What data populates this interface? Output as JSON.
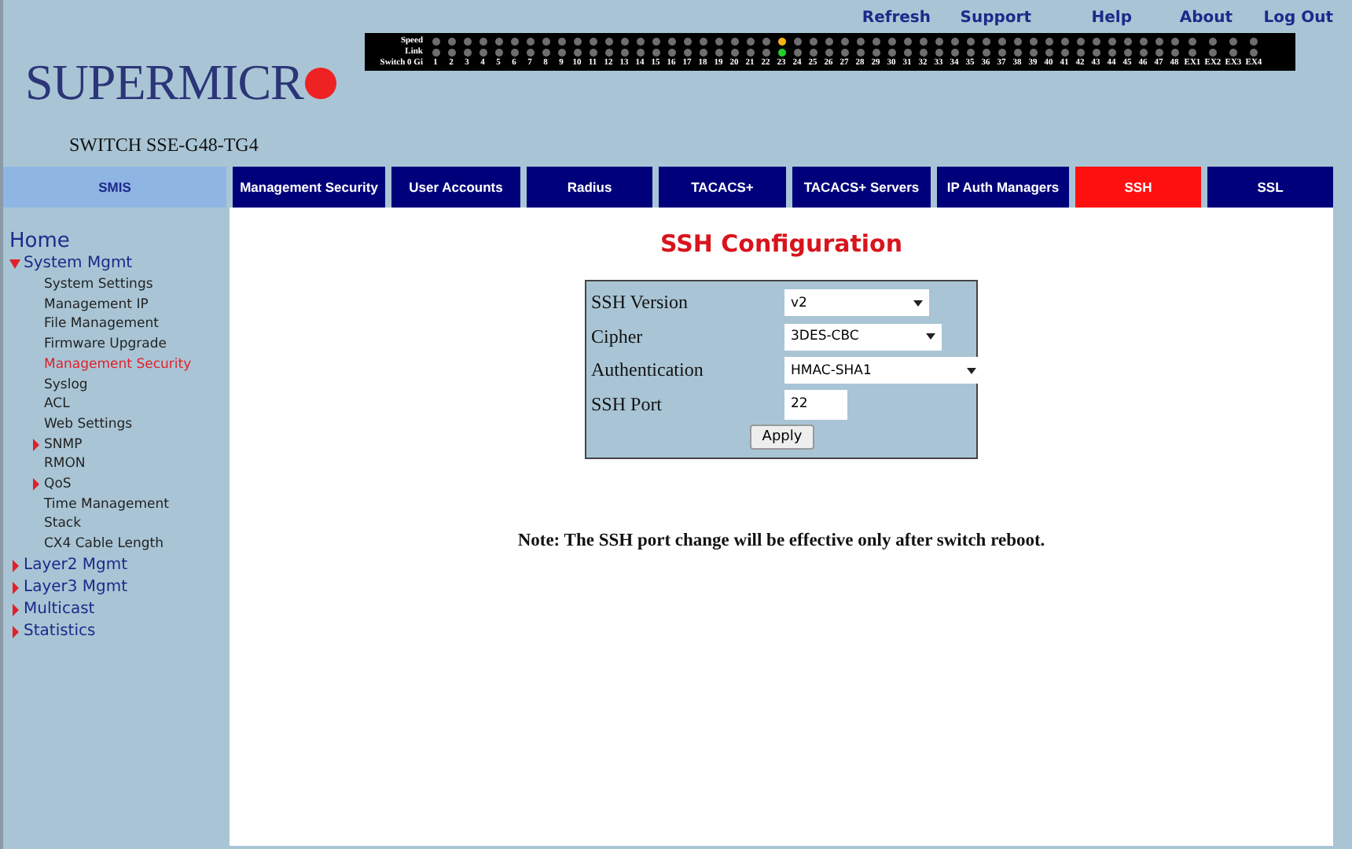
{
  "logo": {
    "text": "SUPERMICR",
    "model": "SWITCH SSE-G48-TG4"
  },
  "top_links": [
    "Refresh",
    "Support",
    "Help",
    "About",
    "Log Out"
  ],
  "port_panel": {
    "row_labels": [
      "Speed",
      "Link",
      "Switch 0 Gi"
    ],
    "ports": [
      {
        "label": "1",
        "speed": {
          "color": "#6e6e6e"
        },
        "link": {
          "color": "#6e6e6e"
        }
      },
      {
        "label": "2",
        "speed": {
          "color": "#6e6e6e"
        },
        "link": {
          "color": "#6e6e6e"
        }
      },
      {
        "label": "3",
        "speed": {
          "color": "#6e6e6e"
        },
        "link": {
          "color": "#6e6e6e"
        }
      },
      {
        "label": "4",
        "speed": {
          "color": "#6e6e6e"
        },
        "link": {
          "color": "#6e6e6e"
        }
      },
      {
        "label": "5",
        "speed": {
          "color": "#6e6e6e"
        },
        "link": {
          "color": "#6e6e6e"
        }
      },
      {
        "label": "6",
        "speed": {
          "color": "#6e6e6e"
        },
        "link": {
          "color": "#6e6e6e"
        }
      },
      {
        "label": "7",
        "speed": {
          "color": "#6e6e6e"
        },
        "link": {
          "color": "#6e6e6e"
        }
      },
      {
        "label": "8",
        "speed": {
          "color": "#6e6e6e"
        },
        "link": {
          "color": "#6e6e6e"
        }
      },
      {
        "label": "9",
        "speed": {
          "color": "#6e6e6e"
        },
        "link": {
          "color": "#6e6e6e"
        }
      },
      {
        "label": "10",
        "speed": {
          "color": "#6e6e6e"
        },
        "link": {
          "color": "#6e6e6e"
        }
      },
      {
        "label": "11",
        "speed": {
          "color": "#6e6e6e"
        },
        "link": {
          "color": "#6e6e6e"
        }
      },
      {
        "label": "12",
        "speed": {
          "color": "#6e6e6e"
        },
        "link": {
          "color": "#6e6e6e"
        }
      },
      {
        "label": "13",
        "speed": {
          "color": "#6e6e6e"
        },
        "link": {
          "color": "#6e6e6e"
        }
      },
      {
        "label": "14",
        "speed": {
          "color": "#6e6e6e"
        },
        "link": {
          "color": "#6e6e6e"
        }
      },
      {
        "label": "15",
        "speed": {
          "color": "#6e6e6e"
        },
        "link": {
          "color": "#6e6e6e"
        }
      },
      {
        "label": "16",
        "speed": {
          "color": "#6e6e6e"
        },
        "link": {
          "color": "#6e6e6e"
        }
      },
      {
        "label": "17",
        "speed": {
          "color": "#6e6e6e"
        },
        "link": {
          "color": "#6e6e6e"
        }
      },
      {
        "label": "18",
        "speed": {
          "color": "#6e6e6e"
        },
        "link": {
          "color": "#6e6e6e"
        }
      },
      {
        "label": "19",
        "speed": {
          "color": "#6e6e6e"
        },
        "link": {
          "color": "#6e6e6e"
        }
      },
      {
        "label": "20",
        "speed": {
          "color": "#6e6e6e"
        },
        "link": {
          "color": "#6e6e6e"
        }
      },
      {
        "label": "21",
        "speed": {
          "color": "#6e6e6e"
        },
        "link": {
          "color": "#6e6e6e"
        }
      },
      {
        "label": "22",
        "speed": {
          "color": "#6e6e6e"
        },
        "link": {
          "color": "#6e6e6e"
        }
      },
      {
        "label": "23",
        "speed": {
          "color": "#f5b21a"
        },
        "link": {
          "color": "#22d02a"
        }
      },
      {
        "label": "24",
        "speed": {
          "color": "#6e6e6e"
        },
        "link": {
          "color": "#6e6e6e"
        }
      },
      {
        "label": "25",
        "speed": {
          "color": "#6e6e6e"
        },
        "link": {
          "color": "#6e6e6e"
        }
      },
      {
        "label": "26",
        "speed": {
          "color": "#6e6e6e"
        },
        "link": {
          "color": "#6e6e6e"
        }
      },
      {
        "label": "27",
        "speed": {
          "color": "#6e6e6e"
        },
        "link": {
          "color": "#6e6e6e"
        }
      },
      {
        "label": "28",
        "speed": {
          "color": "#6e6e6e"
        },
        "link": {
          "color": "#6e6e6e"
        }
      },
      {
        "label": "29",
        "speed": {
          "color": "#6e6e6e"
        },
        "link": {
          "color": "#6e6e6e"
        }
      },
      {
        "label": "30",
        "speed": {
          "color": "#6e6e6e"
        },
        "link": {
          "color": "#6e6e6e"
        }
      },
      {
        "label": "31",
        "speed": {
          "color": "#6e6e6e"
        },
        "link": {
          "color": "#6e6e6e"
        }
      },
      {
        "label": "32",
        "speed": {
          "color": "#6e6e6e"
        },
        "link": {
          "color": "#6e6e6e"
        }
      },
      {
        "label": "33",
        "speed": {
          "color": "#6e6e6e"
        },
        "link": {
          "color": "#6e6e6e"
        }
      },
      {
        "label": "34",
        "speed": {
          "color": "#6e6e6e"
        },
        "link": {
          "color": "#6e6e6e"
        }
      },
      {
        "label": "35",
        "speed": {
          "color": "#6e6e6e"
        },
        "link": {
          "color": "#6e6e6e"
        }
      },
      {
        "label": "36",
        "speed": {
          "color": "#6e6e6e"
        },
        "link": {
          "color": "#6e6e6e"
        }
      },
      {
        "label": "37",
        "speed": {
          "color": "#6e6e6e"
        },
        "link": {
          "color": "#6e6e6e"
        }
      },
      {
        "label": "38",
        "speed": {
          "color": "#6e6e6e"
        },
        "link": {
          "color": "#6e6e6e"
        }
      },
      {
        "label": "39",
        "speed": {
          "color": "#6e6e6e"
        },
        "link": {
          "color": "#6e6e6e"
        }
      },
      {
        "label": "40",
        "speed": {
          "color": "#6e6e6e"
        },
        "link": {
          "color": "#6e6e6e"
        }
      },
      {
        "label": "41",
        "speed": {
          "color": "#6e6e6e"
        },
        "link": {
          "color": "#6e6e6e"
        }
      },
      {
        "label": "42",
        "speed": {
          "color": "#6e6e6e"
        },
        "link": {
          "color": "#6e6e6e"
        }
      },
      {
        "label": "43",
        "speed": {
          "color": "#6e6e6e"
        },
        "link": {
          "color": "#6e6e6e"
        }
      },
      {
        "label": "44",
        "speed": {
          "color": "#6e6e6e"
        },
        "link": {
          "color": "#6e6e6e"
        }
      },
      {
        "label": "45",
        "speed": {
          "color": "#6e6e6e"
        },
        "link": {
          "color": "#6e6e6e"
        }
      },
      {
        "label": "46",
        "speed": {
          "color": "#6e6e6e"
        },
        "link": {
          "color": "#6e6e6e"
        }
      },
      {
        "label": "47",
        "speed": {
          "color": "#6e6e6e"
        },
        "link": {
          "color": "#6e6e6e"
        }
      },
      {
        "label": "48",
        "speed": {
          "color": "#6e6e6e"
        },
        "link": {
          "color": "#6e6e6e"
        }
      },
      {
        "label": "EX1",
        "speed": {
          "color": "#6e6e6e"
        },
        "link": {
          "color": "#6e6e6e"
        }
      },
      {
        "label": "EX2",
        "speed": {
          "color": "#6e6e6e"
        },
        "link": {
          "color": "#6e6e6e"
        }
      },
      {
        "label": "EX3",
        "speed": {
          "color": "#6e6e6e"
        },
        "link": {
          "color": "#6e6e6e"
        }
      },
      {
        "label": "EX4",
        "speed": {
          "color": "#6e6e6e"
        },
        "link": {
          "color": "#6e6e6e"
        }
      }
    ]
  },
  "tabs": [
    {
      "label": "SMIS",
      "kind": "home",
      "selected": false
    },
    {
      "label": "Management Security",
      "kind": "tab",
      "selected": false
    },
    {
      "label": "User Accounts",
      "kind": "tab",
      "selected": false
    },
    {
      "label": "Radius",
      "kind": "tab",
      "selected": false
    },
    {
      "label": "TACACS+",
      "kind": "tab",
      "selected": false
    },
    {
      "label": "TACACS+ Servers",
      "kind": "tab",
      "selected": false
    },
    {
      "label": "IP Auth Managers",
      "kind": "tab",
      "selected": false
    },
    {
      "label": "SSH",
      "kind": "tab",
      "selected": true
    },
    {
      "label": "SSL",
      "kind": "tab",
      "selected": false
    }
  ],
  "sidebar": {
    "home": "Home",
    "items": [
      {
        "label": "System Mgmt",
        "expanded": true,
        "children": [
          {
            "label": "System Settings",
            "selected": false
          },
          {
            "label": "Management IP",
            "selected": false
          },
          {
            "label": "File Management",
            "selected": false
          },
          {
            "label": "Firmware Upgrade",
            "selected": false
          },
          {
            "label": "Management Security",
            "selected": true
          },
          {
            "label": "Syslog",
            "selected": false
          },
          {
            "label": "ACL",
            "selected": false
          },
          {
            "label": "Web Settings",
            "selected": false
          },
          {
            "label": "SNMP",
            "selected": false,
            "expanded": false
          },
          {
            "label": "RMON",
            "selected": false
          },
          {
            "label": "QoS",
            "selected": false,
            "expanded": false
          },
          {
            "label": "Time Management",
            "selected": false
          },
          {
            "label": "Stack",
            "selected": false
          },
          {
            "label": "CX4 Cable Length",
            "selected": false
          }
        ]
      },
      {
        "label": "Layer2 Mgmt",
        "expanded": false
      },
      {
        "label": "Layer3 Mgmt",
        "expanded": false
      },
      {
        "label": "Multicast",
        "expanded": false
      },
      {
        "label": "Statistics",
        "expanded": false
      }
    ]
  },
  "content": {
    "title": "SSH Configuration",
    "form": {
      "rows": [
        {
          "label": "SSH Version",
          "kind": "select",
          "value": "v2"
        },
        {
          "label": "Cipher",
          "kind": "select",
          "value": "3DES-CBC"
        },
        {
          "label": "Authentication",
          "kind": "select",
          "value": "HMAC-SHA1"
        },
        {
          "label": "SSH Port",
          "kind": "input",
          "value": "22"
        }
      ],
      "button": "Apply"
    },
    "note": "Note: The SSH port change will be effective only after switch reboot."
  }
}
